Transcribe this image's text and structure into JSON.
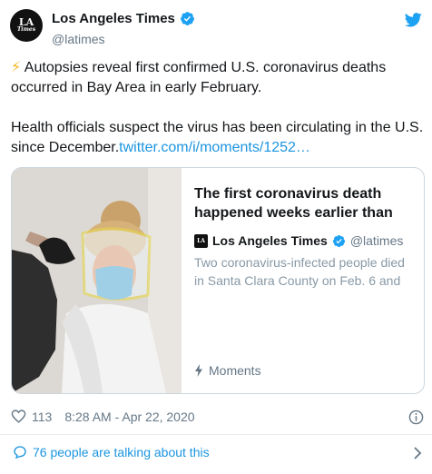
{
  "account": {
    "display_name": "Los Angeles Times",
    "handle": "@latimes",
    "avatar_text_top": "LA",
    "avatar_text_bottom": "Times"
  },
  "tweet": {
    "line1": "Autopsies reveal first confirmed U.S. coronavirus deaths occurred in Bay Area in early February.",
    "line2_text": "Health officials suspect the virus has been circulating in the U.S. since December.",
    "line2_link": "twitter.com/i/moments/1252…"
  },
  "card": {
    "title": "The first coronavirus death happened weeks earlier than",
    "author_name": "Los Angeles Times",
    "author_handle": "@latimes",
    "description": "Two coronavirus-infected people died in Santa Clara County on Feb. 6 and",
    "footer_label": "Moments"
  },
  "meta": {
    "likes": "113",
    "timestamp": "8:28 AM - Apr 22, 2020"
  },
  "conversation": {
    "label": "76 people are talking about this"
  },
  "colors": {
    "link": "#1b95e0",
    "verified": "#1da1f2",
    "muted": "#657786",
    "bolt": "#f5b71b"
  },
  "icons": {
    "verified": "verified-badge-icon",
    "brand": "twitter-bird-icon",
    "bolt": "lightning-bolt-icon",
    "like": "heart-icon",
    "info": "info-icon",
    "moments": "lightning-bolt-icon",
    "reply": "speech-bubble-icon",
    "chevron": "chevron-right-icon"
  }
}
